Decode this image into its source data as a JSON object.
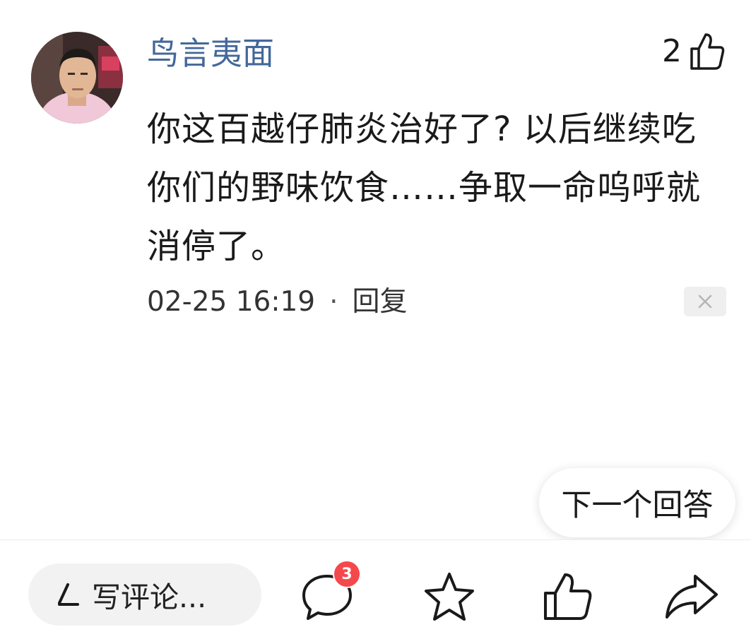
{
  "comment": {
    "username": "鸟言夷面",
    "like_count": "2",
    "content": "你这百越仔肺炎治好了? 以后继续吃你们的野味饮食……争取一命呜呼就消停了。",
    "timestamp": "02-25 16:19",
    "separator": "·",
    "reply_label": "回复"
  },
  "next_answer_label": "下一个回答",
  "bottom_bar": {
    "write_placeholder": "写评论...",
    "comment_badge": "3"
  },
  "colors": {
    "username": "#43679a",
    "badge": "#f5484d"
  }
}
